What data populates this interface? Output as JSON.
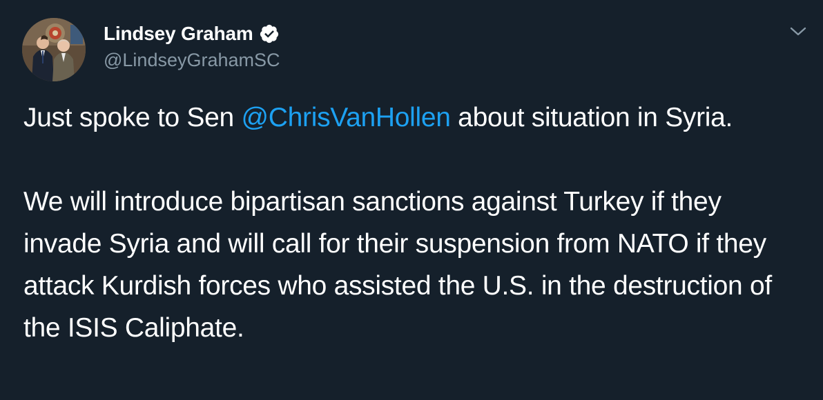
{
  "tweet": {
    "author": {
      "display_name": "Lindsey Graham",
      "handle": "@LindseyGrahamSC",
      "verified": true
    },
    "text": {
      "p1_before": "Just spoke to Sen ",
      "p1_mention": "@ChrisVanHollen",
      "p1_after": " about situation in Syria.",
      "p2": "We will introduce bipartisan sanctions against Turkey if they invade Syria and will call for their suspension from NATO if they attack Kurdish forces who assisted the U.S. in the destruction of the ISIS Caliphate."
    },
    "icons": {
      "verified": "verified-badge-icon",
      "menu": "chevron-down-icon"
    }
  },
  "colors": {
    "background": "#15202b",
    "text": "#ffffff",
    "secondary_text": "#8899a6",
    "link": "#1da1f2"
  }
}
